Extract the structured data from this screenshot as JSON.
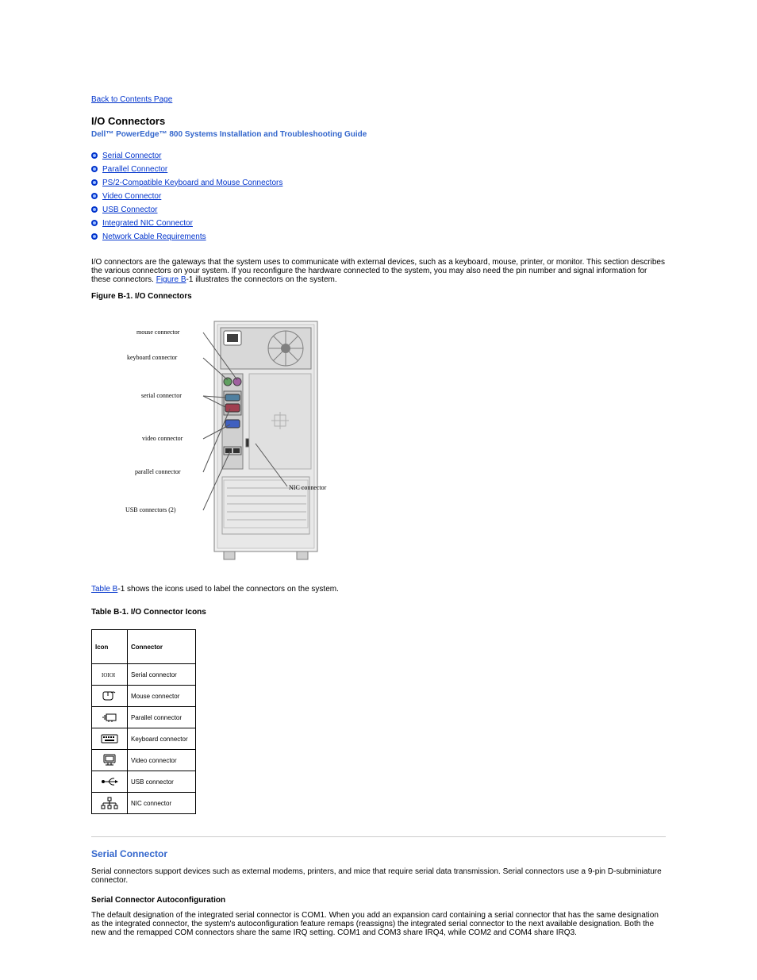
{
  "topLink": "Back to Contents Page",
  "title": "I/O Connectors",
  "subtitle": "Dell™ PowerEdge™ 800 Systems Installation and Troubleshooting Guide",
  "bullets": [
    "Serial Connector",
    "Parallel Connector",
    "PS/2-Compatible Keyboard and Mouse Connectors",
    "Video Connector",
    "USB Connector",
    "Integrated NIC Connector",
    "Network Cable Requirements"
  ],
  "intro": {
    "before": "I/O connectors are the gateways that the system uses to communicate with external devices, such as a keyboard, mouse, printer, or monitor. This section describes the various connectors on your system. If you reconfigure the hardware connected to the system, you may also need the pin number and signal information for these connectors. ",
    "linkText": "Figure B",
    "linkSuffix": "-1",
    "after": " illustrates the connectors on the system."
  },
  "figureCaption": {
    "prefix": "Figure B-",
    "num": "1. I/O Connectors"
  },
  "diagramLabels": {
    "mouse": "mouse connector",
    "keyboard": "keyboard connector",
    "serial": "serial connector",
    "video": "video connector",
    "parallel": "parallel connector",
    "usb": "USB connectors (2)",
    "nic": "NIC connector"
  },
  "tableCaption": {
    "linkText": "Table B",
    "linkSuffix": "-1",
    "after": " shows the icons used to label the connectors on the system."
  },
  "tableCaptionBold": {
    "prefix": " Table B-",
    "rest": "1. I/O Connector Icons"
  },
  "table": {
    "headers": [
      "Icon",
      "Connector"
    ],
    "rows": [
      {
        "icon": "serial",
        "label": "Serial connector"
      },
      {
        "icon": "mouse",
        "label": "Mouse connector"
      },
      {
        "icon": "parallel",
        "label": "Parallel connector"
      },
      {
        "icon": "keyboard",
        "label": "Keyboard connector"
      },
      {
        "icon": "video",
        "label": "Video connector"
      },
      {
        "icon": "usb",
        "label": "USB connector"
      },
      {
        "icon": "nic",
        "label": "NIC connector"
      }
    ]
  },
  "section2": {
    "heading": "Serial Connector",
    "para1": "Serial connectors support devices such as external modems, printers, and mice that require serial data transmission. Serial connectors use a 9-pin D-subminiature connector.",
    "subheading": "Serial Connector Autoconfiguration",
    "para2": "The default designation of the integrated serial connector is COM1. When you add an expansion card containing a serial connector that has the same designation as the integrated connector, the system's autoconfiguration feature remaps (reassigns) the integrated serial connector to the next available designation. Both the new and the remapped COM connectors share the same IRQ setting. COM1 and COM3 share IRQ4, while COM2 and COM4 share IRQ3."
  }
}
